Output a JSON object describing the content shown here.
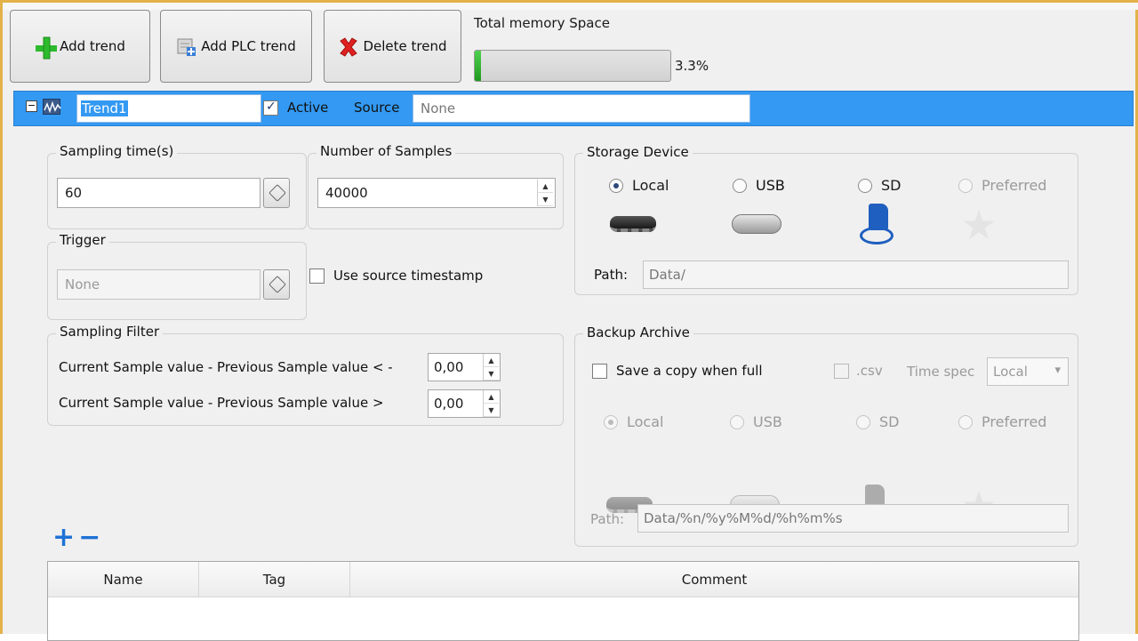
{
  "toolbar": {
    "add_trend": "Add trend",
    "add_plc_trend": "Add PLC trend",
    "delete_trend": "Delete trend",
    "memory_label": "Total memory Space",
    "memory_percent": "3.3%",
    "memory_fraction": 0.033
  },
  "trend": {
    "name": "Trend1",
    "active_label": "Active",
    "active_checked": true,
    "source_label": "Source",
    "source_value": "None"
  },
  "sampling_time": {
    "label": "Sampling time(s)",
    "value": "60"
  },
  "samples": {
    "label": "Number of Samples",
    "value": "40000"
  },
  "trigger": {
    "label": "Trigger",
    "value": "None",
    "use_source_timestamp": "Use source timestamp"
  },
  "filter": {
    "label": "Sampling Filter",
    "row1_text": "Current Sample value - Previous Sample value < -",
    "row1_value": "0,00",
    "row2_text": "Current Sample value - Previous Sample value >",
    "row2_value": "0,00"
  },
  "storage": {
    "label": "Storage Device",
    "options": [
      "Local",
      "USB",
      "SD",
      "Preferred"
    ],
    "selected": "Local",
    "path_label": "Path:",
    "path_value": "Data/"
  },
  "backup": {
    "label": "Backup Archive",
    "save_copy": "Save a copy when full",
    "csv": ".csv",
    "time_spec_label": "Time spec",
    "time_spec_value": "Local",
    "options": [
      "Local",
      "USB",
      "SD",
      "Preferred"
    ],
    "selected": "Local",
    "path_label": "Path:",
    "path_value": "Data/%n/%y%M%d/%h%m%s"
  },
  "table": {
    "columns": [
      "Name",
      "Tag",
      "Comment"
    ]
  },
  "colors": {
    "accent": "#3399f3",
    "frame": "#e3b24a",
    "add_green": "#2dbb2d",
    "delete_red": "#e02020",
    "plus_minus_blue": "#1f72d6"
  },
  "icons": [
    "add-icon",
    "plc-trend-icon",
    "delete-icon",
    "collapse-icon",
    "trend-wave-icon",
    "tag-icon",
    "spin-up-icon",
    "spin-down-icon",
    "local-chip-icon",
    "usb-drive-icon",
    "sd-card-icon",
    "star-icon",
    "plus-icon",
    "minus-icon",
    "dropdown-arrow-icon"
  ]
}
